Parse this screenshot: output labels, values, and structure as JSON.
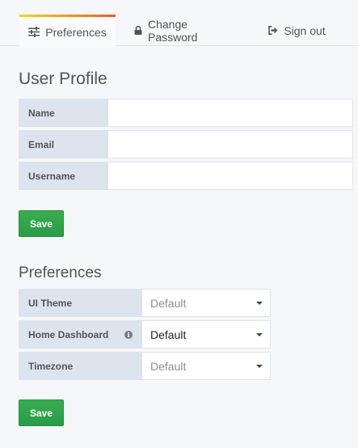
{
  "tabs": {
    "preferences": "Preferences",
    "change_password": "Change Password",
    "sign_out": "Sign out"
  },
  "profile": {
    "title": "User Profile",
    "name_label": "Name",
    "name_value": "",
    "email_label": "Email",
    "email_value": "",
    "username_label": "Username",
    "username_value": "",
    "save_label": "Save"
  },
  "preferences": {
    "title": "Preferences",
    "ui_theme_label": "UI Theme",
    "ui_theme_value": "Default",
    "home_dashboard_label": "Home Dashboard",
    "home_dashboard_value": "Default",
    "timezone_label": "Timezone",
    "timezone_value": "Default",
    "save_label": "Save"
  },
  "colors": {
    "accent_gradient_start": "#ffd500",
    "accent_gradient_end": "#f05a28",
    "save_button": "#299c46",
    "label_background": "#dde4ed"
  },
  "icons": {
    "preferences": "sliders-icon",
    "change_password": "lock-icon",
    "sign_out": "sign-out-icon",
    "home_dashboard_info": "info-icon"
  }
}
